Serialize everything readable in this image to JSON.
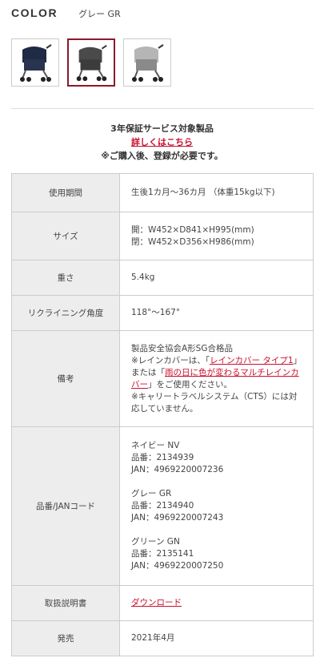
{
  "color": {
    "label": "COLOR",
    "selected": "グレー GR",
    "swatches": [
      {
        "name": "ネイビー",
        "frame": "#2f3347",
        "canopy": "#1f2a44"
      },
      {
        "name": "グレー",
        "frame": "#3a3a3a",
        "canopy": "#4a4a4a"
      },
      {
        "name": "グリーン",
        "frame": "#6a6a6a",
        "canopy": "#b5b5b5"
      }
    ]
  },
  "warranty": {
    "title": "3年保証サービス対象製品",
    "link": "詳しくはこちら",
    "note": "※ご購入後、登録が必要です。"
  },
  "specs": {
    "period": {
      "label": "使用期間",
      "value": "生後1カ月〜36カ月 （体重15kg以下)"
    },
    "size": {
      "label": "サイズ",
      "lines": [
        "開：W452×D841×H995(mm)",
        "閉：W452×D356×H986(mm)"
      ]
    },
    "weight": {
      "label": "重さ",
      "value": "5.4kg"
    },
    "recline": {
      "label": "リクライニング角度",
      "value": "118°〜167°"
    },
    "notes": {
      "label": "備考",
      "line1": "製品安全協会A形SG合格品",
      "p1": "※レインカバーは、「",
      "link1": "レインカバー タイプ1",
      "p2": "」または「",
      "link2": "雨の日に色が変わるマルチレインカバー",
      "p3": "」をご使用ください。",
      "line3": "※キャリートラベルシステム（CTS）には対応していません。"
    },
    "jan": {
      "label": "品番/JANコード",
      "groups": [
        {
          "name": "ネイビー NV",
          "code": "品番：2134939",
          "jan": "JAN：4969220007236"
        },
        {
          "name": "グレー GR",
          "code": "品番：2134940",
          "jan": "JAN：4969220007243"
        },
        {
          "name": "グリーン GN",
          "code": "品番：2135141",
          "jan": "JAN：4969220007250"
        }
      ]
    },
    "manual": {
      "label": "取扱説明書",
      "link": "ダウンロード"
    },
    "release": {
      "label": "発売",
      "value": "2021年4月"
    }
  }
}
